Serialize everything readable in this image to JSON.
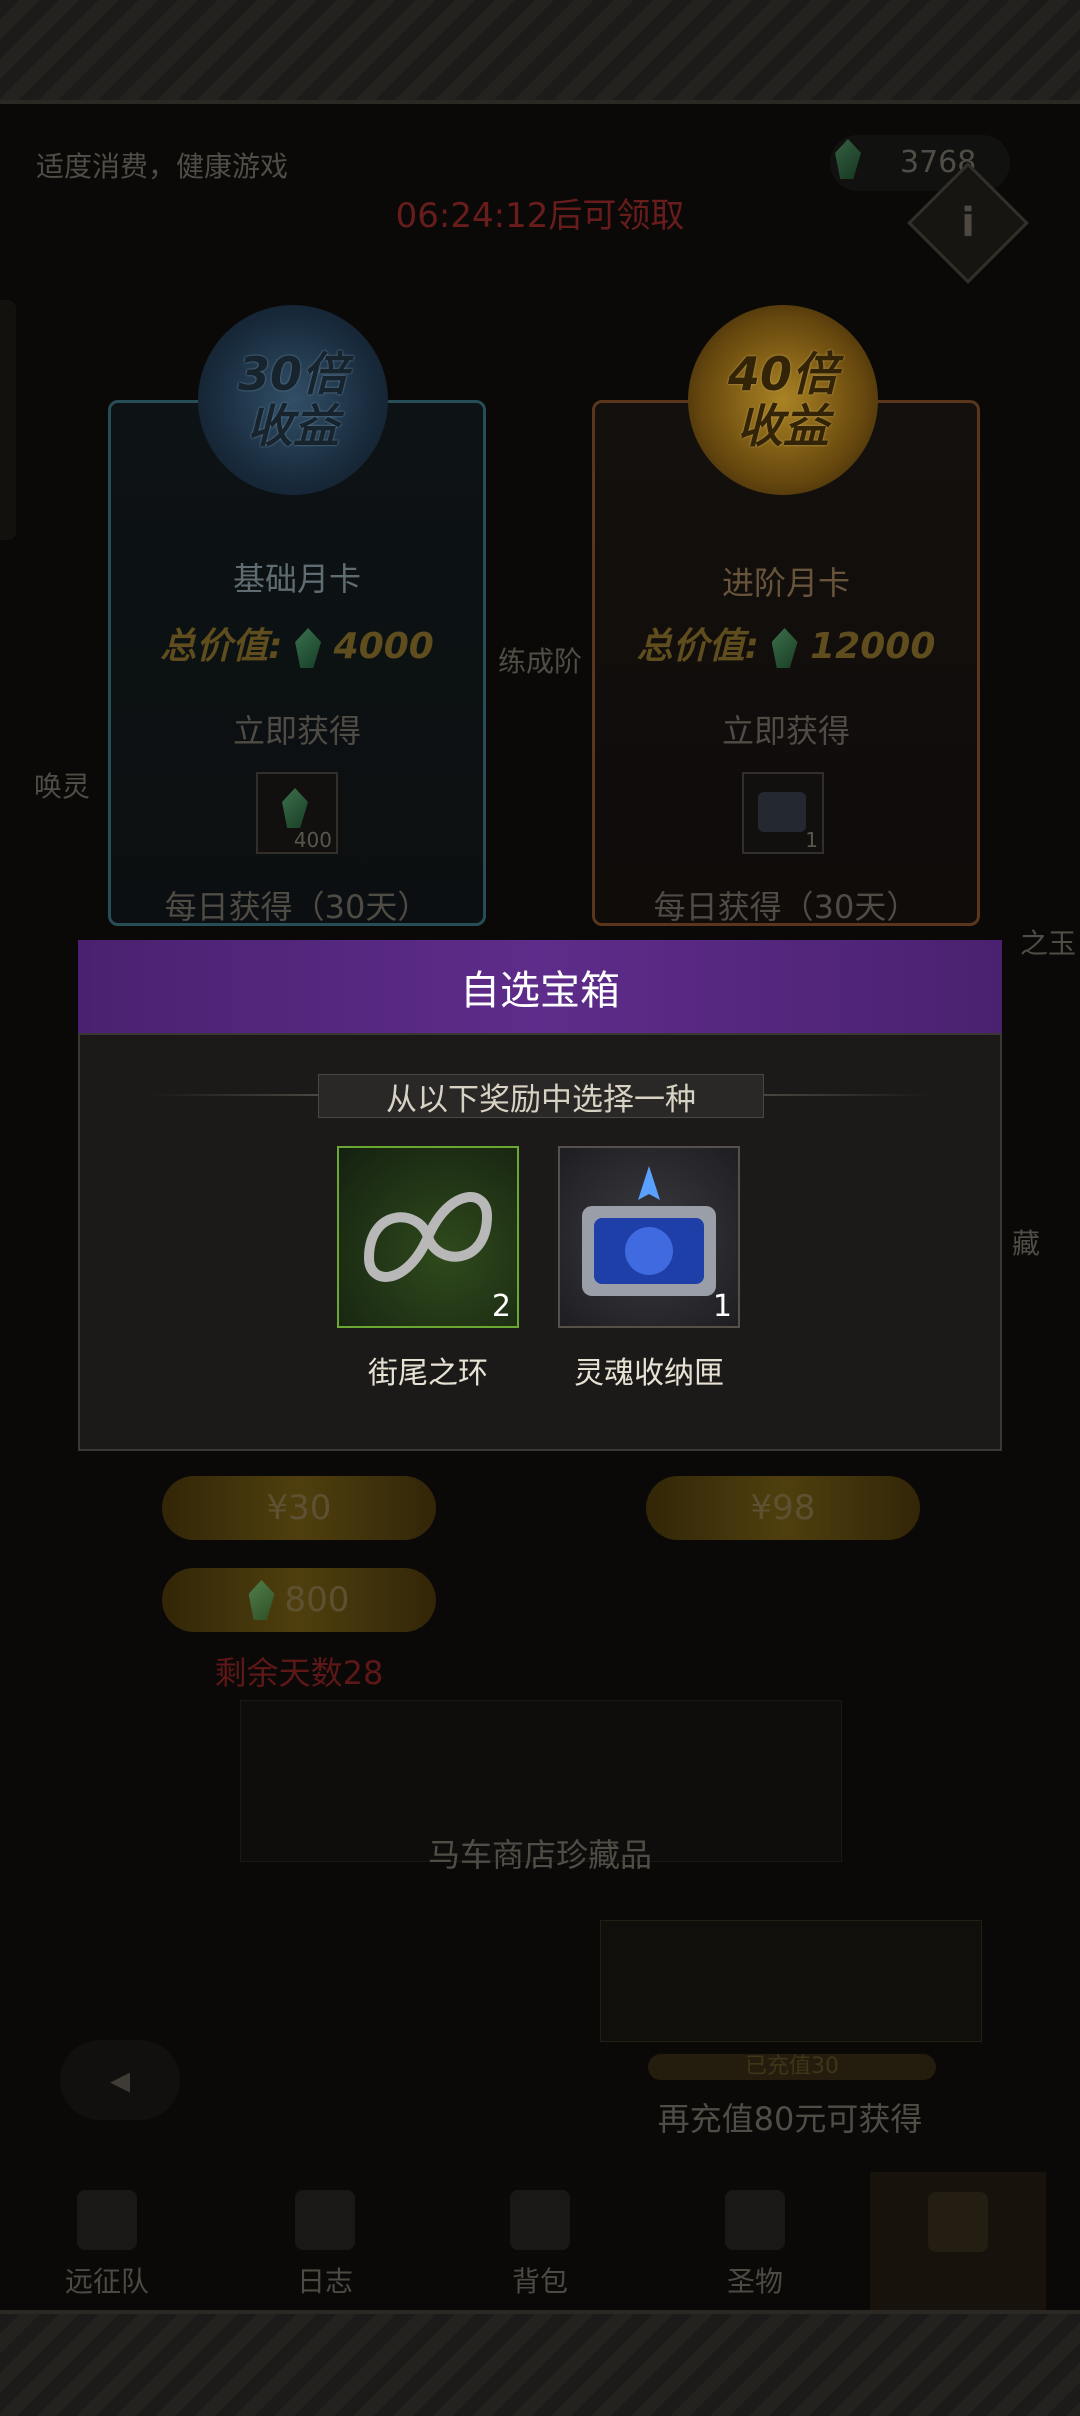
{
  "header": {
    "notice": "适度消费，健康游戏",
    "currency_amount": "3768",
    "countdown": "06:24:12后可领取"
  },
  "background_labels": {
    "left_side": "唤灵",
    "center_partial": "练成阶",
    "right_side_1": "之玉",
    "right_side_2": "藏",
    "right_side_3": "藏"
  },
  "cards": {
    "basic": {
      "badge_line1": "30倍",
      "badge_line2": "收益",
      "title": "基础月卡",
      "total_label": "总价值:",
      "total_value": "4000",
      "instant_label": "立即获得",
      "instant_item_count": "400",
      "daily_label": "每日获得（30天）",
      "price": "¥30",
      "daily_amount": "800",
      "remaining_days": "剩余天数28"
    },
    "advanced": {
      "badge_line1": "40倍",
      "badge_line2": "收益",
      "title": "进阶月卡",
      "total_label": "总价值:",
      "total_value": "12000",
      "instant_label": "立即获得",
      "instant_item_count": "1",
      "daily_label": "每日获得（30天）",
      "price": "¥98"
    }
  },
  "promo": {
    "shop_label": "马车商店珍藏品",
    "progress_label": "已充值30",
    "recharge_hint": "再充值80元可获得"
  },
  "bottom_nav": [
    {
      "label": "远征队",
      "icon": "helmet-icon"
    },
    {
      "label": "日志",
      "icon": "journal-icon"
    },
    {
      "label": "背包",
      "icon": "bag-icon"
    },
    {
      "label": "圣物",
      "icon": "relic-icon"
    },
    {
      "label": "",
      "icon": "shop-icon"
    }
  ],
  "modal": {
    "title": "自选宝箱",
    "prompt": "从以下奖励中选择一种",
    "rewards": [
      {
        "name": "街尾之环",
        "count": "2",
        "icon": "ring-icon"
      },
      {
        "name": "灵魂收纳匣",
        "count": "1",
        "icon": "chest-icon"
      }
    ]
  },
  "colors": {
    "modal_header": "#5e2c8a",
    "countdown_text": "#7a1f1f",
    "remaining_days_text": "#6d1a1a"
  }
}
